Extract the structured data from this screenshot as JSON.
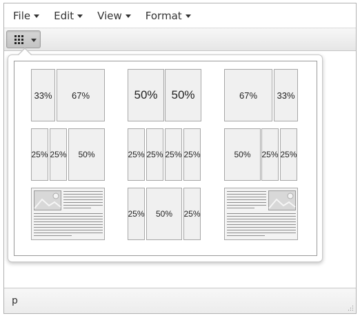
{
  "menubar": {
    "items": [
      {
        "label": "File"
      },
      {
        "label": "Edit"
      },
      {
        "label": "View"
      },
      {
        "label": "Format"
      }
    ]
  },
  "toolbar": {
    "template_button_icon": "grid-icon"
  },
  "templates": {
    "row1": [
      {
        "cols": [
          "33%",
          "67%"
        ]
      },
      {
        "cols": [
          "50%",
          "50%"
        ]
      },
      {
        "cols": [
          "67%",
          "33%"
        ]
      }
    ],
    "row2": [
      {
        "cols": [
          "25%",
          "25%",
          "50%"
        ]
      },
      {
        "cols": [
          "25%",
          "25%",
          "25%",
          "25%"
        ]
      },
      {
        "cols": [
          "50%",
          "25%",
          "25%"
        ]
      }
    ],
    "row3": [
      {
        "type": "image-left-text-right"
      },
      {
        "cols": [
          "25%",
          "50%",
          "25%"
        ]
      },
      {
        "type": "image-right-text-left"
      }
    ]
  },
  "statusbar": {
    "path": "p"
  }
}
